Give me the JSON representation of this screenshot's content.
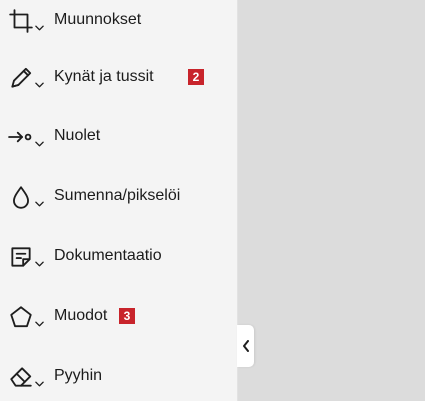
{
  "colors": {
    "sidebar_bg": "#f4f4f4",
    "canvas_bg": "#dcdcdc",
    "badge_bg": "#c8242b",
    "text": "#1c1c1c"
  },
  "tools": [
    {
      "label": "Muunnokset",
      "icon": "crop-icon",
      "badge": ""
    },
    {
      "label": "Kynät ja tussit",
      "icon": "pen-icon",
      "badge": "2"
    },
    {
      "label": "Nuolet",
      "icon": "arrow-icon",
      "badge": ""
    },
    {
      "label": "Sumenna/pikselöi",
      "icon": "droplet-icon",
      "badge": ""
    },
    {
      "label": "Dokumentaatio",
      "icon": "note-icon",
      "badge": ""
    },
    {
      "label": "Muodot",
      "icon": "pentagon-icon",
      "badge": "3"
    },
    {
      "label": "Pyyhin",
      "icon": "eraser-icon",
      "badge": ""
    }
  ],
  "collapse_button": {
    "icon": "chevron-left-icon"
  }
}
